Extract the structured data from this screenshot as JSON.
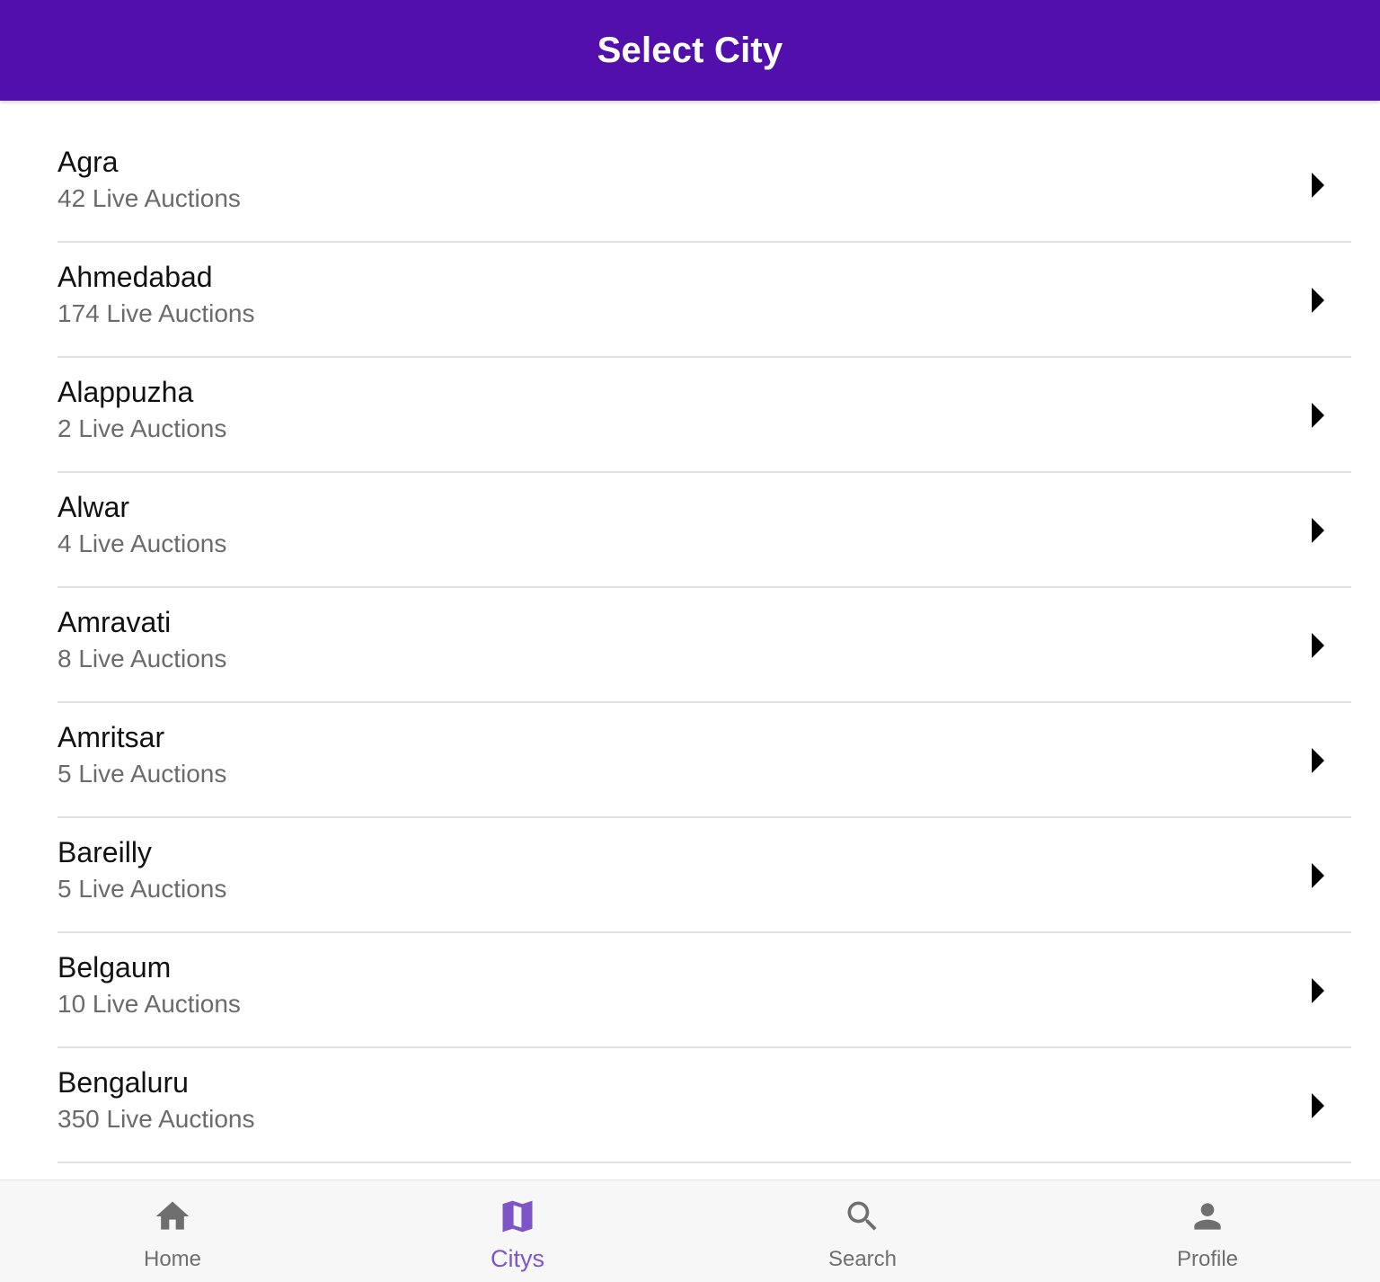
{
  "colors": {
    "primary": "#520fab",
    "accent": "#7e55c7",
    "nav_inactive": "#6f6f6f"
  },
  "header": {
    "title": "Select City"
  },
  "cities": [
    {
      "name": "Agra",
      "count": "42 Live Auctions"
    },
    {
      "name": "Ahmedabad",
      "count": "174 Live Auctions"
    },
    {
      "name": "Alappuzha",
      "count": "2 Live Auctions"
    },
    {
      "name": "Alwar",
      "count": "4 Live Auctions"
    },
    {
      "name": "Amravati",
      "count": "8 Live Auctions"
    },
    {
      "name": "Amritsar",
      "count": "5 Live Auctions"
    },
    {
      "name": "Bareilly",
      "count": "5 Live Auctions"
    },
    {
      "name": "Belgaum",
      "count": "10 Live Auctions"
    },
    {
      "name": "Bengaluru",
      "count": "350 Live Auctions"
    }
  ],
  "row_icon": "chevron-right-icon",
  "bottom_nav": {
    "active": "citys",
    "tabs": [
      {
        "id": "home",
        "label": "Home",
        "icon": "home-icon"
      },
      {
        "id": "citys",
        "label": "Citys",
        "icon": "map-icon"
      },
      {
        "id": "search",
        "label": "Search",
        "icon": "search-icon"
      },
      {
        "id": "profile",
        "label": "Profile",
        "icon": "person-icon"
      }
    ]
  }
}
